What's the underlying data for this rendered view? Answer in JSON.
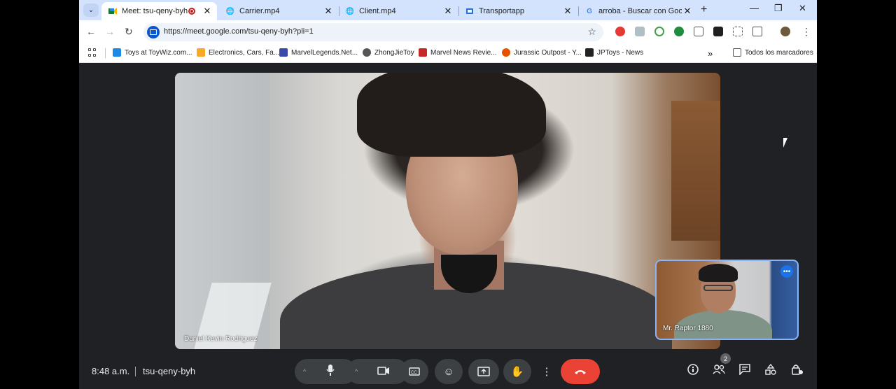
{
  "browser": {
    "tabs": [
      {
        "title": "Meet: tsu-qeny-byh",
        "icon": "meet-icon",
        "recording": true
      },
      {
        "title": "Carrier.mp4",
        "icon": "globe-icon"
      },
      {
        "title": "Client.mp4",
        "icon": "globe-icon"
      },
      {
        "title": "Transportapp",
        "icon": "page-icon"
      },
      {
        "title": "arroba - Buscar con Google",
        "icon": "google-icon"
      }
    ],
    "url": "https://meet.google.com/tsu-qeny-byh?pli=1",
    "bookmarks": [
      {
        "label": "Toys at ToyWiz.com...",
        "color": "#1e88e5"
      },
      {
        "label": "Electronics, Cars, Fa...",
        "color": "#f9a825"
      },
      {
        "label": "MarvelLegends.Net...",
        "color": "#3949ab"
      },
      {
        "label": "ZhongJieToy",
        "color": "#555555"
      },
      {
        "label": "Marvel News Revie...",
        "color": "#c62828"
      },
      {
        "label": "Jurassic Outpost - Y...",
        "color": "#e65100"
      },
      {
        "label": "JPToys - News",
        "color": "#222222"
      }
    ],
    "all_bookmarks": "Todos los marcadores"
  },
  "meet": {
    "main_participant": "Daniel Kevin Rodriguez",
    "self_participant": "Mr. Raptor 1880",
    "time": "8:48 a.m.",
    "meeting_code": "tsu-qeny-byh",
    "participant_count": "2"
  },
  "colors": {
    "background": "#202124",
    "hangup": "#ea4335",
    "accent": "#8ab4f8"
  }
}
